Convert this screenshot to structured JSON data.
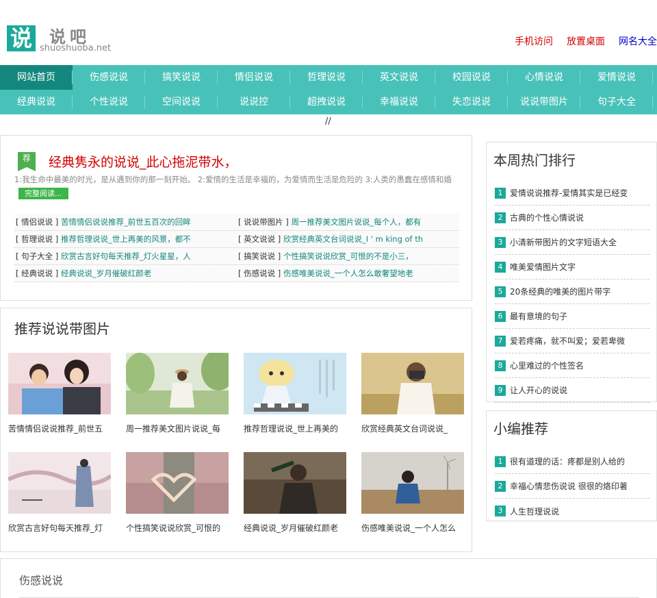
{
  "header": {
    "logo_char": "说",
    "logo_name": "说吧",
    "logo_domain": "shuoshuoba.net",
    "links": [
      "手机访问",
      "放置桌面",
      "网名大全"
    ]
  },
  "nav": {
    "row1": [
      "网站首页",
      "伤感说说",
      "搞笑说说",
      "情侣说说",
      "哲理说说",
      "英文说说",
      "校园说说",
      "心情说说",
      "爱情说说"
    ],
    "row2": [
      "经典说说",
      "个性说说",
      "空间说说",
      "说说控",
      "超拽说说",
      "幸福说说",
      "失恋说说",
      "说说带图片",
      "句子大全"
    ]
  },
  "slash": "//",
  "featured": {
    "badge": "荐",
    "title": "经典隽永的说说_此心拖泥带水，",
    "summary": "1:我生命中最美的时光，是从遇到你的那一刻开始。 2:爱情的生活是幸福的，为爱情而生活是危险的 3:人类的愚蠢在感情和婚",
    "read_more": "完整阅读...",
    "rows": [
      [
        {
          "cat": "[ 情侣说说 ]",
          "title": "苦情情侣说说推荐_前世五百次的回眸"
        },
        {
          "cat": "[ 说说带图片 ]",
          "title": "周一推荐美文图片说说_每个人，都有"
        }
      ],
      [
        {
          "cat": "[ 哲理说说 ]",
          "title": "推荐哲理说说_世上再美的风景，都不"
        },
        {
          "cat": "[ 英文说说 ]",
          "title": "欣赏经典英文台词说说_I ' m king of th"
        }
      ],
      [
        {
          "cat": "[ 句子大全 ]",
          "title": "欣赏古言好句每天推荐_灯火星星，人"
        },
        {
          "cat": "[ 搞笑说说 ]",
          "title": "个性搞笑说说欣赏_可恨的不是小三，"
        }
      ],
      [
        {
          "cat": "[ 经典说说 ]",
          "title": "经典说说_岁月催破红颜老"
        },
        {
          "cat": "[ 伤感说说 ]",
          "title": "伤感唯美说说_一个人怎么敢奢望地老"
        }
      ]
    ]
  },
  "pics": {
    "title": "推荐说说带图片",
    "items": [
      {
        "caption": "苦情情侣说说推荐_前世五"
      },
      {
        "caption": "周一推荐美文图片说说_每"
      },
      {
        "caption": "推荐哲理说说_世上再美的"
      },
      {
        "caption": "欣赏经典英文台词说说_"
      },
      {
        "caption": "欣赏古言好句每天推荐_灯"
      },
      {
        "caption": "个性搞笑说说欣赏_可恨的"
      },
      {
        "caption": "经典说说_岁月催破红颜老"
      },
      {
        "caption": "伤感唯美说说_一个人怎么"
      }
    ]
  },
  "hot": {
    "title": "本周热门排行",
    "items": [
      {
        "num": "1",
        "title": "爱情说说推荐-爱情其实是已经变"
      },
      {
        "num": "2",
        "title": "古典的个性心情说说"
      },
      {
        "num": "3",
        "title": "小清新带图片的文字短语大全"
      },
      {
        "num": "4",
        "title": "唯美爱情图片文字"
      },
      {
        "num": "5",
        "title": "20条经典的唯美的图片带字"
      },
      {
        "num": "6",
        "title": "最有意境的句子"
      },
      {
        "num": "7",
        "title": "爱若疼痛，就不叫爱；爱若卑微"
      },
      {
        "num": "8",
        "title": "心里难过的个性签名"
      },
      {
        "num": "9",
        "title": "让人开心的说说"
      }
    ]
  },
  "editor": {
    "title": "小编推荐",
    "items": [
      {
        "num": "1",
        "title": "很有道理的话：疼都是别人给的"
      },
      {
        "num": "2",
        "title": "幸福心情悲伤说说 很很的烙印著"
      },
      {
        "num": "3",
        "title": "人生哲理说说"
      }
    ]
  },
  "bottom": {
    "title": "伤感说说"
  }
}
